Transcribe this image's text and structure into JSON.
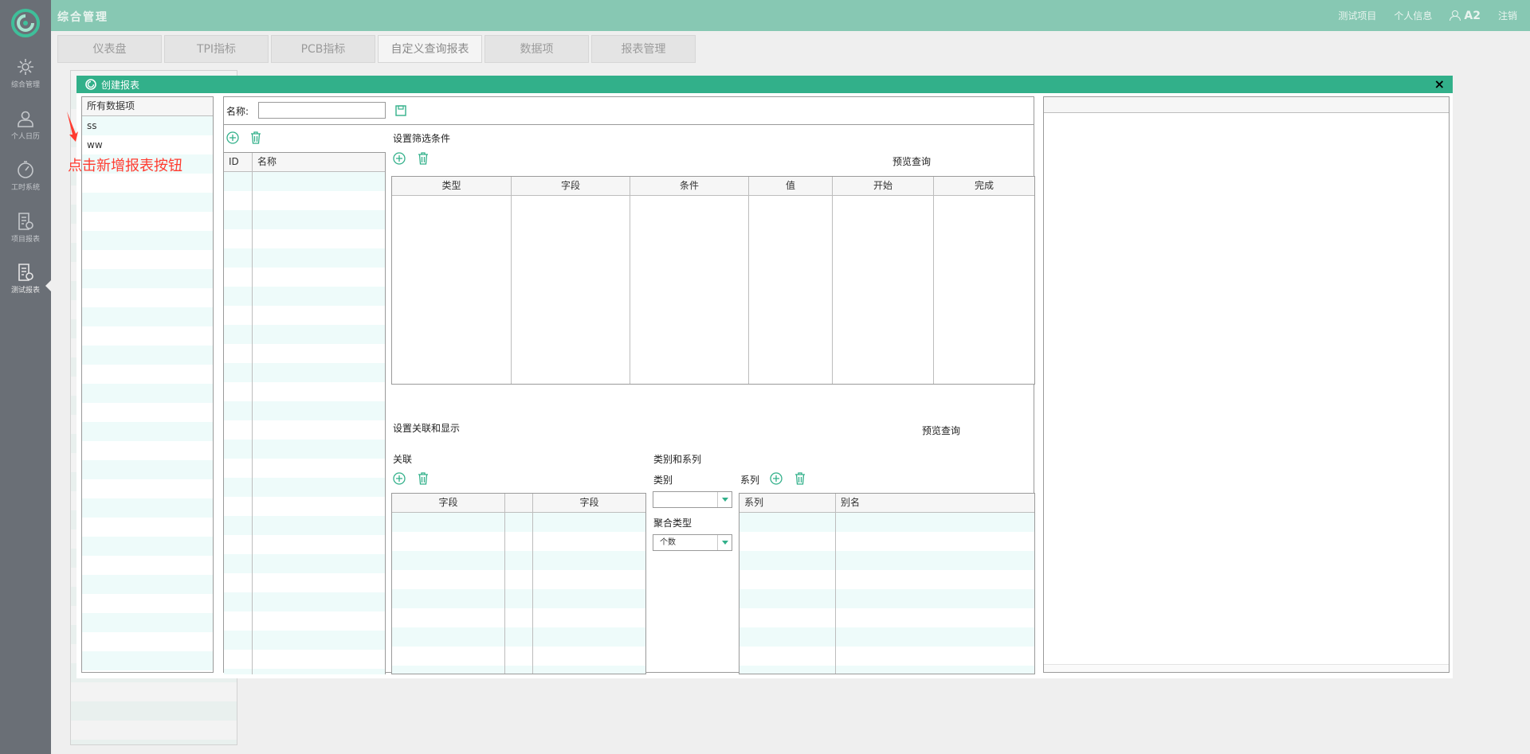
{
  "app": {
    "title": "综合管理"
  },
  "topnav": {
    "project": "测试项目",
    "profile": "个人信息",
    "user": "A2",
    "logout": "注销"
  },
  "sidebar": {
    "items": [
      {
        "label": "综合管理",
        "icon": "gear-icon"
      },
      {
        "label": "个人日历",
        "icon": "person-icon"
      },
      {
        "label": "工时系统",
        "icon": "clock-icon"
      },
      {
        "label": "项目报表",
        "icon": "report-icon"
      },
      {
        "label": "测试报表",
        "icon": "report-icon"
      }
    ]
  },
  "tabs": [
    "仪表盘",
    "TPI指标",
    "PCB指标",
    "自定义查询报表",
    "数据项",
    "报表管理"
  ],
  "active_tab": "自定义查询报表",
  "dialog": {
    "title": "创建报表",
    "close": "×",
    "data_items": {
      "header": "所有数据项",
      "items": [
        "ss",
        "ww"
      ]
    },
    "name_label": "名称:",
    "name_value": "",
    "report_list": {
      "columns": [
        "ID",
        "名称"
      ]
    },
    "filter": {
      "title": "设置筛选条件",
      "preview": "预览查询",
      "columns": [
        "类型",
        "字段",
        "条件",
        "值",
        "开始",
        "完成"
      ]
    },
    "relation": {
      "title": "设置关联和显示",
      "preview": "预览查询",
      "join_label": "关联",
      "join_columns": [
        "字段",
        "",
        "字段"
      ],
      "category_series_label": "类别和系列",
      "category_label": "类别",
      "category_value": "",
      "agg_label": "聚合类型",
      "agg_value": "个数",
      "series_label": "系列",
      "series_columns": [
        "系列",
        "别名"
      ]
    }
  },
  "annotation": {
    "hint": "点击新增报表按钮"
  },
  "colors": {
    "accent": "#32b08a",
    "topbar": "#87c8b3",
    "sidebar": "#6a6f76",
    "hint": "#ff3b30"
  }
}
